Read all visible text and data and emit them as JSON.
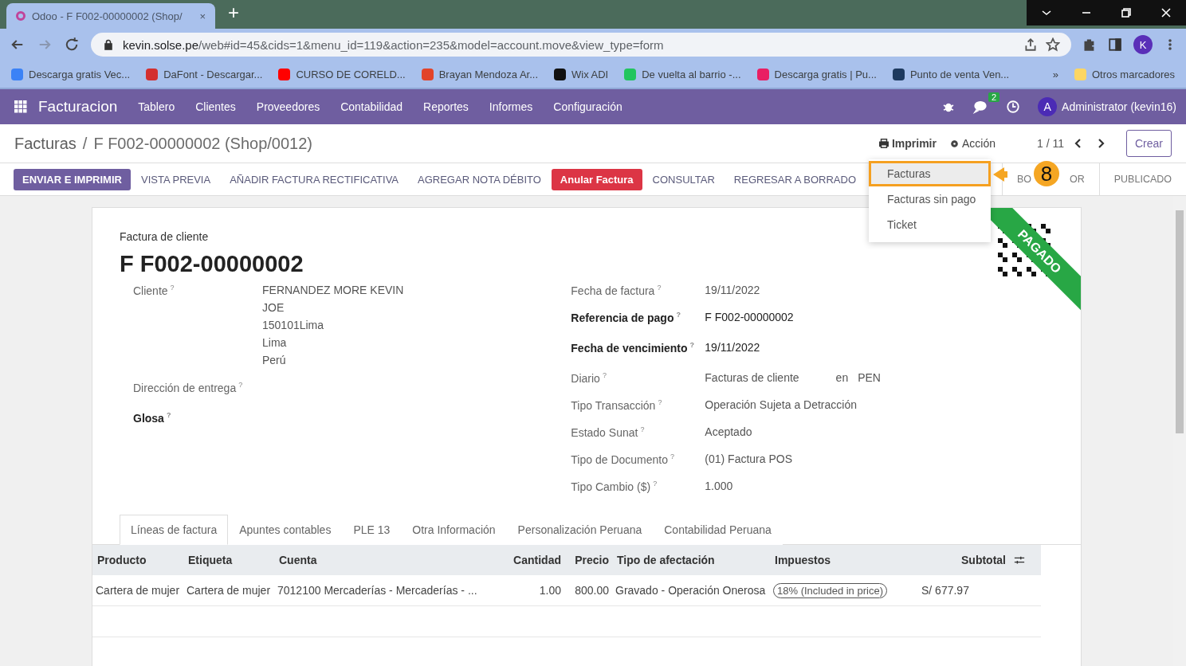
{
  "browser": {
    "tab": {
      "title": "Odoo - F F002-00000002 (Shop/",
      "close": "×"
    },
    "new_tab": "+",
    "url": {
      "host": "kevin.solse.pe",
      "path": "/web#id=45&cids=1&menu_id=119&action=235&model=account.move&view_type=form"
    },
    "profile": "K",
    "bookmarks": [
      {
        "label": "Descarga gratis Vec...",
        "color": "#3b82f6"
      },
      {
        "label": "DaFont - Descargar...",
        "color": "#d32f2f"
      },
      {
        "label": "CURSO DE CORELD...",
        "color": "#ff0000"
      },
      {
        "label": "Brayan Mendoza Ar...",
        "color": "#e24329"
      },
      {
        "label": "Wix ADI",
        "color": "#111111"
      },
      {
        "label": "De vuelta al barrio -...",
        "color": "#22c55e"
      },
      {
        "label": "Descarga gratis | Pu...",
        "color": "#e91e63"
      },
      {
        "label": "Punto de venta Ven...",
        "color": "#1e3a5f"
      }
    ],
    "more": "»",
    "other_bookmarks": "Otros marcadores"
  },
  "navbar": {
    "app": "Facturacion",
    "menu": [
      "Tablero",
      "Clientes",
      "Proveedores",
      "Contabilidad",
      "Reportes",
      "Informes",
      "Configuración"
    ],
    "messages_badge": "2",
    "avatar": "A",
    "user": "Administrator (kevin16)"
  },
  "control_panel": {
    "breadcrumb": [
      "Facturas",
      "F F002-00000002 (Shop/0012)"
    ],
    "separator": "/",
    "print": "Imprimir",
    "action": "Acción",
    "pager": "1 / 11",
    "create": "Crear"
  },
  "buttons": [
    {
      "label": "ENVIAR E IMPRIMIR",
      "kind": "primary"
    },
    {
      "label": "VISTA PREVIA",
      "kind": "plain"
    },
    {
      "label": "AÑADIR FACTURA RECTIFICATIVA",
      "kind": "plain"
    },
    {
      "label": "AGREGAR NOTA DÉBITO",
      "kind": "plain"
    },
    {
      "label": "Anular Factura",
      "kind": "danger"
    },
    {
      "label": "CONSULTAR",
      "kind": "plain"
    },
    {
      "label": "REGRESAR A BORRADO",
      "kind": "plain"
    }
  ],
  "stages": [
    {
      "parts": [
        "BO",
        "OR"
      ]
    },
    {
      "parts": [
        "PUBLICADO"
      ]
    }
  ],
  "print_menu": [
    {
      "label": "Facturas",
      "selected": true
    },
    {
      "label": "Facturas sin pago",
      "selected": false
    },
    {
      "label": "Ticket",
      "selected": false
    }
  ],
  "annotation": {
    "number": "8"
  },
  "sheet": {
    "subtitle": "Factura de cliente",
    "title": "F F002-00000002",
    "ribbon": "PAGADO",
    "left_fields": [
      {
        "label": "Cliente",
        "tip": "?",
        "bold": false,
        "lines": [
          "FERNANDEZ MORE KEVIN",
          "JOE",
          "150101Lima",
          "Lima",
          "Perú"
        ]
      },
      {
        "label": "Dirección de entrega",
        "tip": "?",
        "bold": false
      },
      {
        "label": "Glosa",
        "tip": "?",
        "bold": true
      }
    ],
    "right_fields": [
      {
        "label": "Fecha de factura",
        "tip": "?",
        "bold": false,
        "value": "19/11/2022"
      },
      {
        "label": "Referencia de pago",
        "tip": "?",
        "bold": true,
        "value": "F F002-00000002"
      },
      {
        "label": "Fecha de vencimiento",
        "tip": "?",
        "bold": true,
        "value": "19/11/2022"
      },
      {
        "label": "Diario",
        "tip": "?",
        "bold": false,
        "value": "Facturas de cliente",
        "extra": [
          "en",
          "PEN"
        ]
      },
      {
        "label": "Tipo Transacción",
        "tip": "?",
        "bold": false,
        "value": "Operación Sujeta a Detracción"
      },
      {
        "label": "Estado Sunat",
        "tip": "?",
        "bold": false,
        "value": "Aceptado"
      },
      {
        "label": "Tipo de Documento",
        "tip": "?",
        "bold": false,
        "value": "(01) Factura POS"
      },
      {
        "label": "Tipo Cambio ($)",
        "tip": "?",
        "bold": false,
        "value": "1.000"
      }
    ],
    "tabs": [
      {
        "label": "Líneas de factura",
        "selected": true
      },
      {
        "label": "Apuntes contables",
        "selected": false
      },
      {
        "label": "PLE 13",
        "selected": false
      },
      {
        "label": "Otra Información",
        "selected": false
      },
      {
        "label": "Personalización Peruana",
        "selected": false
      },
      {
        "label": "Contabilidad Peruana",
        "selected": false
      }
    ],
    "table": {
      "columns": [
        "Producto",
        "Etiqueta",
        "Cuenta",
        "Cantidad",
        "Precio",
        "Tipo de afectación",
        "Impuestos",
        "Subtotal"
      ],
      "rows": [
        {
          "producto": "Cartera de mujer",
          "etiqueta": "Cartera de mujer",
          "cuenta": "7012100 Mercaderías - Mercaderías - ...",
          "cantidad": "1.00",
          "precio": "800.00",
          "afectacion": "Gravado - Operación Onerosa",
          "impuesto": "18% (Included in price)",
          "subtotal": "S/ 677.97"
        }
      ]
    }
  }
}
